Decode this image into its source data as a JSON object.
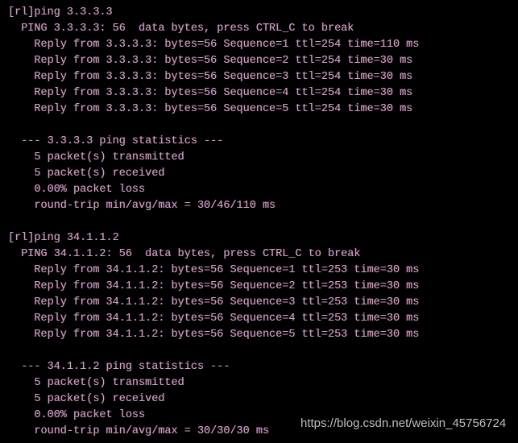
{
  "terminal": {
    "background_color": "#000000",
    "text_color": "#c9a4bd",
    "lines": [
      "[rl]ping 3.3.3.3",
      "  PING 3.3.3.3: 56  data bytes, press CTRL_C to break",
      "    Reply from 3.3.3.3: bytes=56 Sequence=1 ttl=254 time=110 ms",
      "    Reply from 3.3.3.3: bytes=56 Sequence=2 ttl=254 time=30 ms",
      "    Reply from 3.3.3.3: bytes=56 Sequence=3 ttl=254 time=30 ms",
      "    Reply from 3.3.3.3: bytes=56 Sequence=4 ttl=254 time=30 ms",
      "    Reply from 3.3.3.3: bytes=56 Sequence=5 ttl=254 time=30 ms",
      "",
      "  --- 3.3.3.3 ping statistics ---",
      "    5 packet(s) transmitted",
      "    5 packet(s) received",
      "    0.00% packet loss",
      "    round-trip min/avg/max = 30/46/110 ms",
      "",
      "[rl]ping 34.1.1.2",
      "  PING 34.1.1.2: 56  data bytes, press CTRL_C to break",
      "    Reply from 34.1.1.2: bytes=56 Sequence=1 ttl=253 time=30 ms",
      "    Reply from 34.1.1.2: bytes=56 Sequence=2 ttl=253 time=30 ms",
      "    Reply from 34.1.1.2: bytes=56 Sequence=3 ttl=253 time=30 ms",
      "    Reply from 34.1.1.2: bytes=56 Sequence=4 ttl=253 time=30 ms",
      "    Reply from 34.1.1.2: bytes=56 Sequence=5 ttl=253 time=30 ms",
      "",
      "  --- 34.1.1.2 ping statistics ---",
      "    5 packet(s) transmitted",
      "    5 packet(s) received",
      "    0.00% packet loss",
      "    round-trip min/avg/max = 30/30/30 ms"
    ]
  },
  "watermark": {
    "text": "https://blog.csdn.net/weixin_45756724",
    "color": "#cfcfcf"
  }
}
